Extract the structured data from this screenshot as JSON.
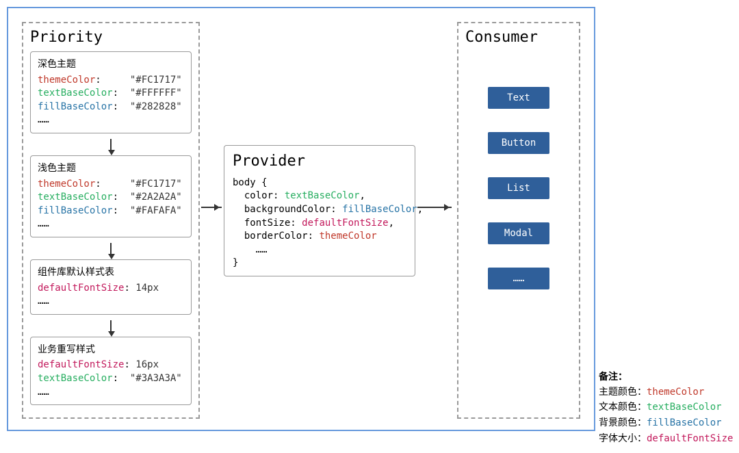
{
  "priority": {
    "title": "Priority",
    "boxes": [
      {
        "title": "深色主题",
        "lines": [
          {
            "key": "themeColor",
            "keyClass": "tok-red",
            "value": "\"#FC1717\""
          },
          {
            "key": "textBaseColor",
            "keyClass": "tok-green",
            "value": "\"#FFFFFF\""
          },
          {
            "key": "fillBaseColor",
            "keyClass": "tok-blue",
            "value": "\"#282828\""
          }
        ],
        "ellipsis": "……"
      },
      {
        "title": "浅色主题",
        "lines": [
          {
            "key": "themeColor",
            "keyClass": "tok-red",
            "value": "\"#FC1717\""
          },
          {
            "key": "textBaseColor",
            "keyClass": "tok-green",
            "value": "\"#2A2A2A\""
          },
          {
            "key": "fillBaseColor",
            "keyClass": "tok-blue",
            "value": "\"#FAFAFA\""
          }
        ],
        "ellipsis": "……"
      },
      {
        "title": "组件库默认样式表",
        "lines": [
          {
            "key": "defaultFontSize",
            "keyClass": "tok-pink",
            "value": "14px"
          }
        ],
        "ellipsis": "……"
      },
      {
        "title": "业务重写样式",
        "lines": [
          {
            "key": "defaultFontSize",
            "keyClass": "tok-pink",
            "value": "16px"
          },
          {
            "key": "textBaseColor",
            "keyClass": "tok-green",
            "value": "\"#3A3A3A\""
          }
        ],
        "ellipsis": "……"
      }
    ]
  },
  "provider": {
    "title": "Provider",
    "body_open": "body {",
    "lines": [
      {
        "prop": "color",
        "val": "textBaseColor",
        "valClass": "tok-green",
        "trail": ","
      },
      {
        "prop": "backgroundColor",
        "val": "fillBaseColor",
        "valClass": "tok-blue",
        "trail": ","
      },
      {
        "prop": "fontSize",
        "val": "defaultFontSize",
        "valClass": "tok-pink",
        "trail": ","
      },
      {
        "prop": "borderColor",
        "val": "themeColor",
        "valClass": "tok-red",
        "trail": ""
      }
    ],
    "ellipsis": "……",
    "body_close": "}"
  },
  "consumer": {
    "title": "Consumer",
    "items": [
      "Text",
      "Button",
      "List",
      "Modal",
      "……"
    ]
  },
  "legend": {
    "header": "备注：",
    "rows": [
      {
        "label": "主题颜色：",
        "token": "themeColor",
        "tokenClass": "tok-red"
      },
      {
        "label": "文本颜色：",
        "token": "textBaseColor",
        "tokenClass": "tok-green"
      },
      {
        "label": "背景颜色：",
        "token": "fillBaseColor",
        "tokenClass": "tok-blue"
      },
      {
        "label": "字体大小：",
        "token": "defaultFontSize",
        "tokenClass": "tok-pink"
      }
    ]
  }
}
